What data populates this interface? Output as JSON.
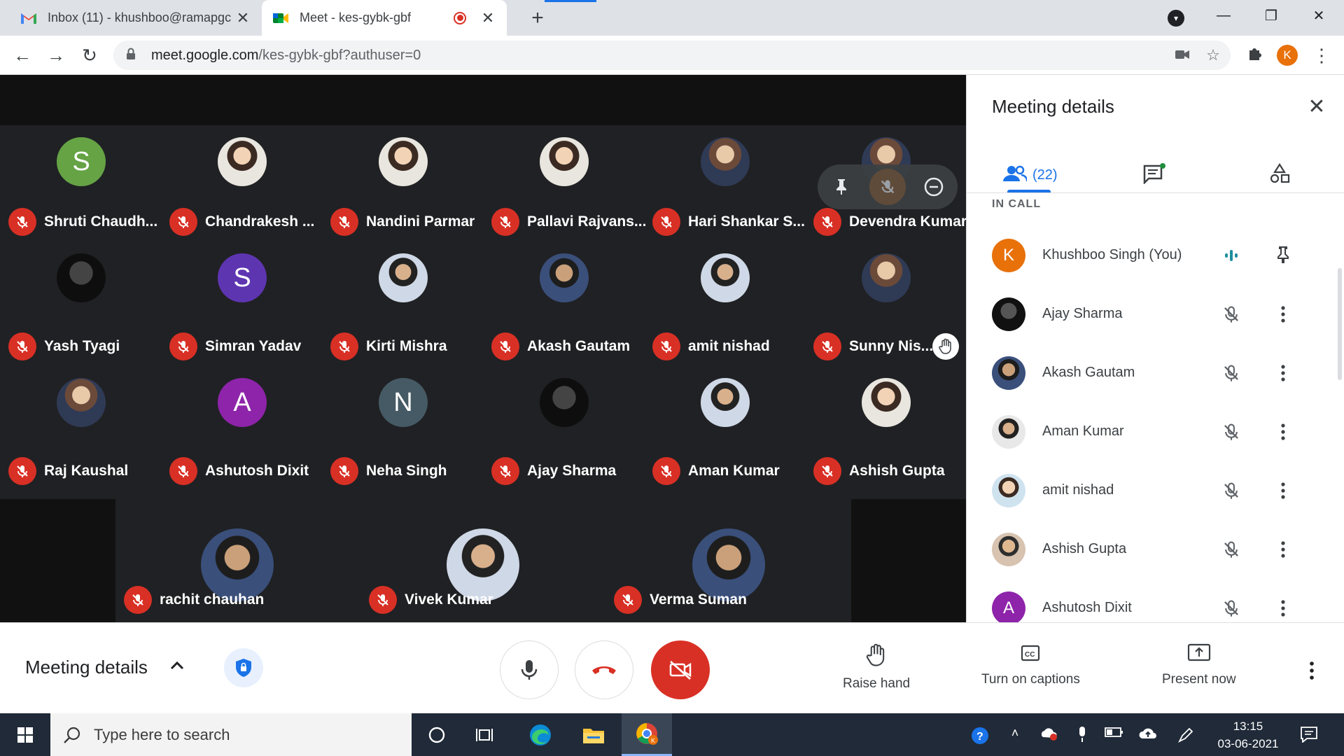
{
  "browser": {
    "tabs": [
      {
        "title": "Inbox (11) - khushboo@ramapgc",
        "icon": "gmail-icon"
      },
      {
        "title": "Meet - kes-gybk-gbf",
        "icon": "meet-icon",
        "recording": true
      }
    ],
    "url_host": "meet.google.com",
    "url_path": "/kes-gybk-gbf?authuser=0",
    "profile_initial": "K"
  },
  "stage": {
    "tiles": [
      {
        "name": "Shruti Chaudh...",
        "avatar_letter": "S",
        "avatar_color": "#65a345"
      },
      {
        "name": "Chandrakesh ...",
        "avatar_letter": "",
        "avatar_color": "#f6d36b"
      },
      {
        "name": "Nandini Parmar",
        "avatar_letter": "",
        "avatar_color": "#e6b81c"
      },
      {
        "name": "Pallavi Rajvans...",
        "avatar_letter": "",
        "avatar_color": "#d9b08c"
      },
      {
        "name": "Hari Shankar S...",
        "avatar_letter": "",
        "avatar_color": "#8a4b2a"
      },
      {
        "name": "Devendra Kumar",
        "avatar_letter": "",
        "avatar_color": "#6e5a4a"
      },
      {
        "name": "Yash Tyagi",
        "avatar_letter": "",
        "avatar_color": "#2a2f3a"
      },
      {
        "name": "Simran Yadav",
        "avatar_letter": "S",
        "avatar_color": "#5e35b1"
      },
      {
        "name": "Kirti Mishra",
        "avatar_letter": "",
        "avatar_color": "#d8d2cc"
      },
      {
        "name": "Akash Gautam",
        "avatar_letter": "",
        "avatar_color": "#3a5a8a"
      },
      {
        "name": "amit nishad",
        "avatar_letter": "",
        "avatar_color": "#cfe3ef"
      },
      {
        "name": "Sunny Nis...",
        "avatar_letter": "",
        "avatar_color": "#c7a07c"
      },
      {
        "name": "Raj Kaushal",
        "avatar_letter": "",
        "avatar_color": "#a64646"
      },
      {
        "name": "Ashutosh Dixit",
        "avatar_letter": "A",
        "avatar_color": "#8e24aa"
      },
      {
        "name": "Neha Singh",
        "avatar_letter": "N",
        "avatar_color": "#455a64"
      },
      {
        "name": "Ajay Sharma",
        "avatar_letter": "",
        "avatar_color": "#1a1a22"
      },
      {
        "name": "Aman Kumar",
        "avatar_letter": "",
        "avatar_color": "#e8e8e8"
      },
      {
        "name": "Ashish Gupta",
        "avatar_letter": "",
        "avatar_color": "#d7c3b0"
      },
      {
        "name": "rachit chauhan",
        "avatar_letter": "",
        "avatar_color": "#1e6b6b"
      },
      {
        "name": "Vivek Kumar",
        "avatar_letter": "",
        "avatar_color": "#c9d9e8"
      },
      {
        "name": "Verma Suman",
        "avatar_letter": "",
        "avatar_color": "#6a7bb5"
      }
    ]
  },
  "panel": {
    "title": "Meeting details",
    "people_count": "(22)",
    "section_label": "IN CALL",
    "participants": [
      {
        "name": "Khushboo Singh (You)",
        "avatar_letter": "K",
        "avatar_color": "#e8710a"
      },
      {
        "name": "Ajay Sharma",
        "avatar_letter": "",
        "avatar_color": "#1a1a22"
      },
      {
        "name": "Akash Gautam",
        "avatar_letter": "",
        "avatar_color": "#3a5a8a"
      },
      {
        "name": "Aman Kumar",
        "avatar_letter": "",
        "avatar_color": "#e8e8e8"
      },
      {
        "name": "amit nishad",
        "avatar_letter": "",
        "avatar_color": "#cfe3ef"
      },
      {
        "name": "Ashish Gupta",
        "avatar_letter": "",
        "avatar_color": "#d7c3b0"
      },
      {
        "name": "Ashutosh Dixit",
        "avatar_letter": "A",
        "avatar_color": "#8e24aa"
      }
    ]
  },
  "controls": {
    "meeting_details_label": "Meeting details",
    "raise_hand_label": "Raise hand",
    "captions_label": "Turn on captions",
    "present_label": "Present now"
  },
  "taskbar": {
    "search_placeholder": "Type here to search",
    "time": "13:15",
    "date": "03-06-2021"
  },
  "colors": {
    "accent": "#1a73e8",
    "danger": "#d93025",
    "stage_bg": "#202124"
  }
}
